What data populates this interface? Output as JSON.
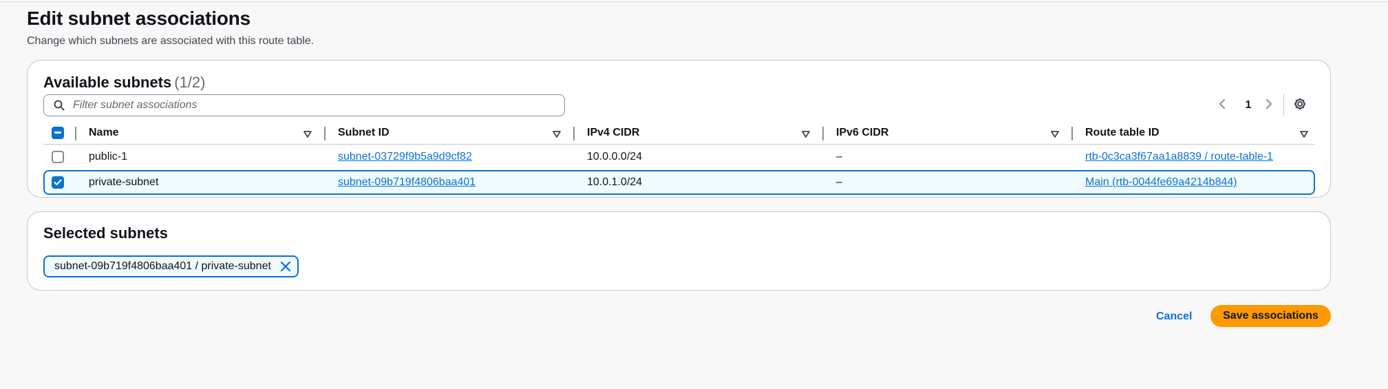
{
  "page": {
    "title": "Edit subnet associations",
    "description": "Change which subnets are associated with this route table."
  },
  "available": {
    "heading": "Available subnets",
    "count": "(1/2)",
    "filter_placeholder": "Filter subnet associations",
    "page_number": "1",
    "columns": [
      "Name",
      "Subnet ID",
      "IPv4 CIDR",
      "IPv6 CIDR",
      "Route table ID"
    ],
    "rows": [
      {
        "checked": false,
        "name": "public-1",
        "subnet_id": "subnet-03729f9b5a9d9cf82",
        "ipv4": "10.0.0.0/24",
        "ipv6": "–",
        "route_table": "rtb-0c3ca3f67aa1a8839 / route-table-1"
      },
      {
        "checked": true,
        "name": "private-subnet",
        "subnet_id": "subnet-09b719f4806baa401",
        "ipv4": "10.0.1.0/24",
        "ipv6": "–",
        "route_table": "Main (rtb-0044fe69a4214b844)"
      }
    ]
  },
  "selected": {
    "heading": "Selected subnets",
    "tokens": [
      "subnet-09b719f4806baa401 / private-subnet"
    ]
  },
  "actions": {
    "cancel": "Cancel",
    "save": "Save associations"
  },
  "icons": {
    "search": "search-icon",
    "settings": "gear-icon",
    "remove": "close-icon",
    "sort": "sort-down-icon",
    "prev": "chevron-left-icon",
    "next": "chevron-right-icon"
  },
  "colors": {
    "link": "#0972d3",
    "primary_button": "#ff9900",
    "selected_row_bg": "#f0fbff"
  }
}
